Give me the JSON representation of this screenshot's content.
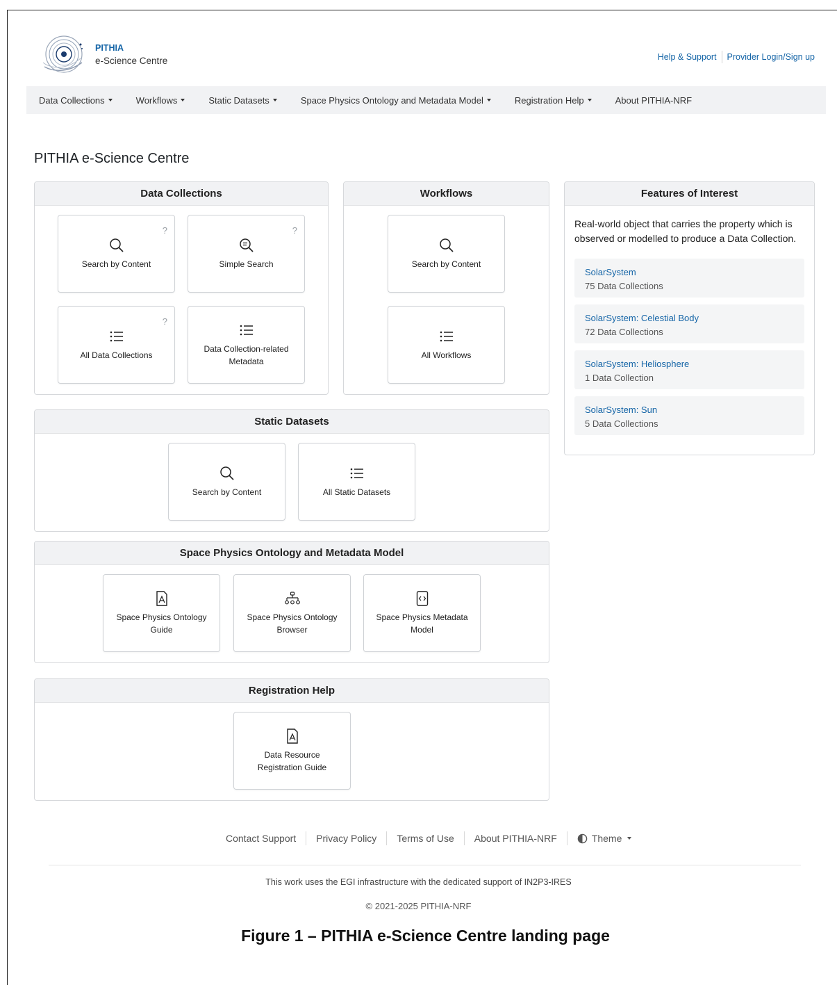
{
  "header": {
    "brand_name": "PITHIA",
    "brand_sub": "e-Science Centre",
    "links": [
      "Help & Support",
      "Provider Login/Sign up"
    ]
  },
  "nav": [
    {
      "label": "Data Collections",
      "dropdown": true
    },
    {
      "label": "Workflows",
      "dropdown": true
    },
    {
      "label": "Static Datasets",
      "dropdown": true
    },
    {
      "label": "Space Physics Ontology and Metadata Model",
      "dropdown": true
    },
    {
      "label": "Registration Help",
      "dropdown": true
    },
    {
      "label": "About PITHIA-NRF",
      "dropdown": false
    }
  ],
  "page_title": "PITHIA e-Science Centre",
  "data_collections": {
    "title": "Data Collections",
    "tiles": [
      {
        "label": "Search by Content",
        "icon": "search-icon",
        "help": "?"
      },
      {
        "label": "Simple Search",
        "icon": "simple-search-icon",
        "help": "?"
      },
      {
        "label": "All Data Collections",
        "icon": "list-icon",
        "help": "?"
      },
      {
        "label": "Data Collection-related Metadata",
        "icon": "list-icon"
      }
    ]
  },
  "workflows": {
    "title": "Workflows",
    "tiles": [
      {
        "label": "Search by Content",
        "icon": "search-icon"
      },
      {
        "label": "All Workflows",
        "icon": "list-icon"
      }
    ]
  },
  "static_datasets": {
    "title": "Static Datasets",
    "tiles": [
      {
        "label": "Search by Content",
        "icon": "search-icon"
      },
      {
        "label": "All Static Datasets",
        "icon": "list-icon"
      }
    ]
  },
  "ontology": {
    "title": "Space Physics Ontology and Metadata Model",
    "tiles": [
      {
        "label": "Space Physics Ontology Guide",
        "icon": "pdf-icon"
      },
      {
        "label": "Space Physics Ontology Browser",
        "icon": "hierarchy-icon"
      },
      {
        "label": "Space Physics Metadata Model",
        "icon": "code-file-icon"
      }
    ]
  },
  "registration": {
    "title": "Registration Help",
    "tiles": [
      {
        "label": "Data Resource Registration Guide",
        "icon": "pdf-icon"
      }
    ]
  },
  "features": {
    "title": "Features of Interest",
    "description": "Real-world object that carries the property which is observed or modelled to produce a Data Collection.",
    "items": [
      {
        "name": "SolarSystem",
        "count": "75 Data Collections"
      },
      {
        "name": "SolarSystem: Celestial Body",
        "count": "72 Data Collections"
      },
      {
        "name": "SolarSystem: Heliosphere",
        "count": "1 Data Collection"
      },
      {
        "name": "SolarSystem: Sun",
        "count": "5 Data Collections"
      }
    ]
  },
  "footer": {
    "links": [
      "Contact Support",
      "Privacy Policy",
      "Terms of Use",
      "About PITHIA-NRF"
    ],
    "theme": "Theme",
    "egi": "This work uses the EGI infrastructure with the dedicated support of IN2P3-IRES",
    "copyright": "© 2021-2025 PITHIA-NRF"
  },
  "caption": "Figure 1 – PITHIA e-Science Centre landing page"
}
